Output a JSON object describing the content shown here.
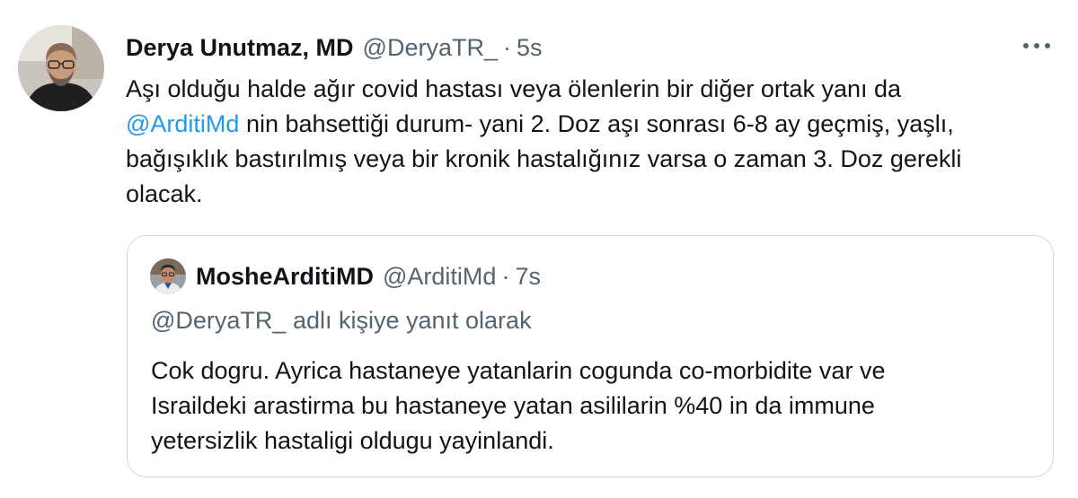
{
  "tweet": {
    "author_name": "Derya Unutmaz, MD",
    "author_handle": "@DeryaTR_",
    "separator": "·",
    "timestamp": "5s",
    "avatar_icon": "profile-photo-man-glasses",
    "more_icon": "more-horizontal-icon",
    "body_lines": [
      {
        "text": "Aşı olduğu halde ağır covid hastası veya ölenlerin bir diğer ortak yanı da"
      },
      {
        "mention": "@ArditiMd",
        "text": " nin bahsettiği durum- yani 2. Doz aşı sonrası 6-8 ay geçmiş, yaşlı,"
      },
      {
        "text": "bağışıklık bastırılmış veya bir kronik hastalığınız varsa o zaman 3. Doz gerekli"
      },
      {
        "text": "olacak."
      }
    ]
  },
  "quoted_tweet": {
    "author_name": "MosheArditiMD",
    "author_handle": "@ArditiMd",
    "separator": "·",
    "timestamp": "7s",
    "avatar_icon": "profile-photo-man-glasses-small",
    "reply_context": "@DeryaTR_ adlı kişiye yanıt olarak",
    "body_lines": [
      "Cok dogru.  Ayrica hastaneye yatanlarin cogunda co-morbidite var ve",
      "Israildeki arastirma bu hastaneye yatan asililarin %40 in da immune",
      "yetersizlik hastaligi oldugu yayinlandi."
    ]
  },
  "colors": {
    "text": "#0f1419",
    "secondary": "#536471",
    "link": "#1d9bf0",
    "border": "#cfd9de"
  }
}
